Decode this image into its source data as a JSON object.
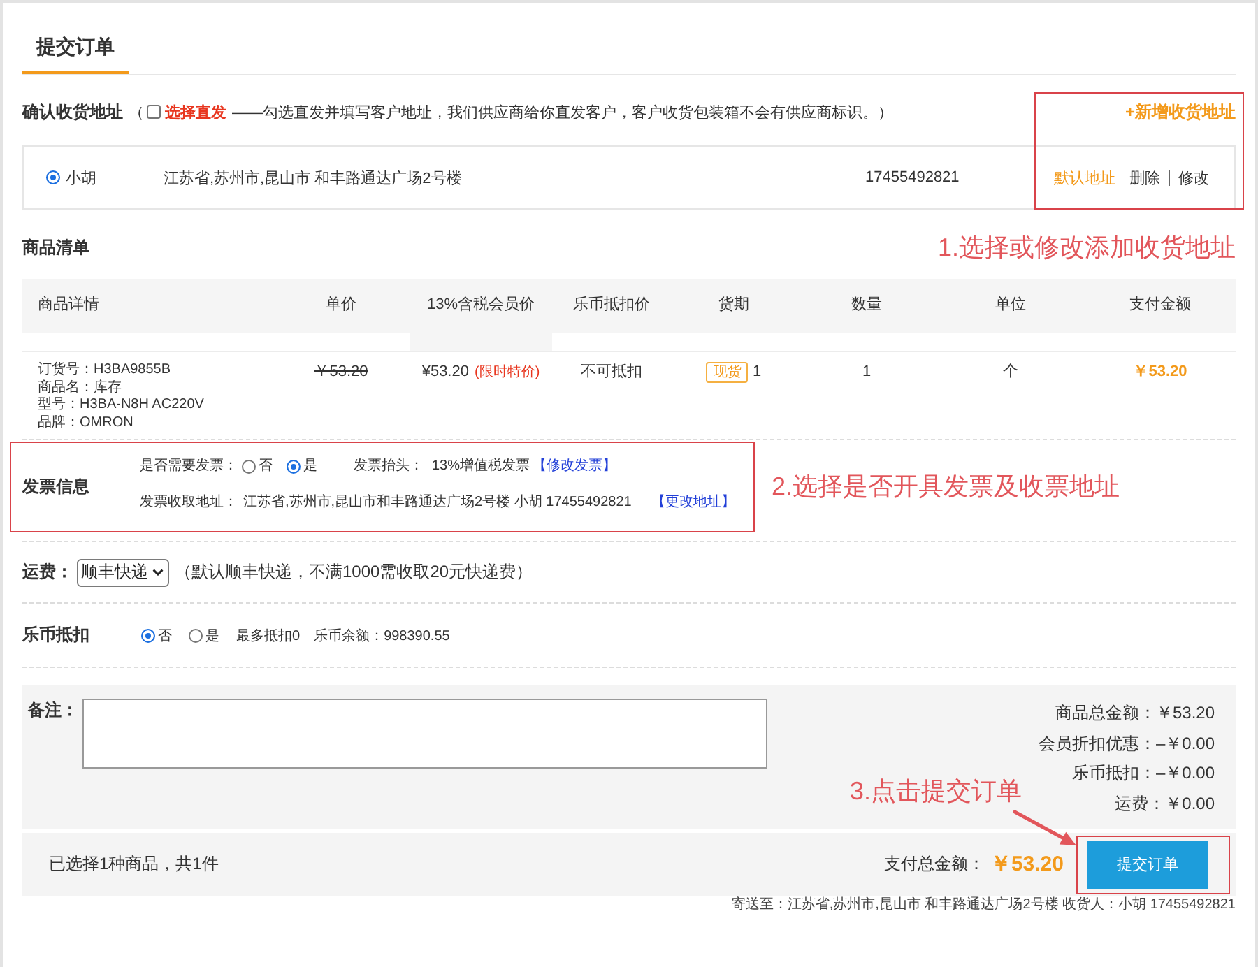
{
  "header": {
    "tab": {
      "label": "提交订单",
      "selected": true
    }
  },
  "address_section": {
    "title": "确认收货地址",
    "open_paren": "（",
    "direct_ship": {
      "label": "选择直发",
      "checked": false
    },
    "description": "——勾选直发并填写客户地址，我们供应商给你直发客户，客户收货包装箱不会有供应商标识。）",
    "add_link": "+新增收货地址",
    "addresses": [
      {
        "name": "小胡",
        "address": "江苏省,苏州市,昆山市 和丰路通达广场2号楼",
        "phone": "17455492821",
        "selected": true,
        "tag": "默认地址",
        "actions": [
          "删除",
          "修改"
        ]
      }
    ]
  },
  "products": {
    "title": "商品清单",
    "annotation": "1.选择或修改添加收货地址",
    "columns": [
      "商品详情",
      "单价",
      "13%含税会员价",
      "乐币抵扣价",
      "货期",
      "数量",
      "单位",
      "支付金额"
    ],
    "rows": [
      {
        "details": [
          "订货号：H3BA9855B",
          "商品名：库存",
          "型号：H3BA-N8H AC220V",
          "品牌：OMRON"
        ],
        "list_price": "￥53.20",
        "member_price": "¥53.20",
        "price_note": "(限时特价)",
        "coin_price": "不可抵扣",
        "availability": "现货",
        "availability_qty": "1",
        "quantity": "1",
        "unit": "个",
        "amount": "￥53.20"
      }
    ]
  },
  "invoice": {
    "title": "发票信息",
    "need_label": "是否需要发票：",
    "options": [
      {
        "label": "否",
        "selected": false
      },
      {
        "label": "是",
        "selected": true
      }
    ],
    "header_label": "发票抬头：",
    "header_value": "13%增值税发票",
    "edit_link": "【修改发票】",
    "address_label": "发票收取地址：",
    "address_value": "江苏省,苏州市,昆山市和丰路通达广场2号楼 小胡 17455492821",
    "change_link": "【更改地址】",
    "annotation": "2.选择是否开具发票及收票地址"
  },
  "shipping": {
    "label": "运费：",
    "method": "顺丰快递",
    "note": "（默认顺丰快递，不满1000需收取20元快递费）"
  },
  "coins": {
    "title": "乐币抵扣",
    "options": [
      {
        "label": "否",
        "selected": true
      },
      {
        "label": "是",
        "selected": false
      }
    ],
    "max_text": "最多抵扣0",
    "balance_text": "乐币余额：998390.55"
  },
  "remarks": {
    "label": "备注：",
    "annotation": "3.点击提交订单"
  },
  "summary": [
    {
      "label": "商品总金额：",
      "value": "￥53.20"
    },
    {
      "label": "会员折扣优惠：",
      "value": "–￥0.00"
    },
    {
      "label": "乐币抵扣：",
      "value": "–￥0.00"
    },
    {
      "label": "运费：",
      "value": "￥0.00"
    }
  ],
  "footer": {
    "selection": "已选择1种商品，共1件",
    "total_label": "支付总金额：",
    "total_value": "￥53.20",
    "submit": "提交订单",
    "ship_to": "寄送至：江苏省,苏州市,昆山市 和丰路通达广场2号楼 收货人：小胡 17455492821"
  }
}
